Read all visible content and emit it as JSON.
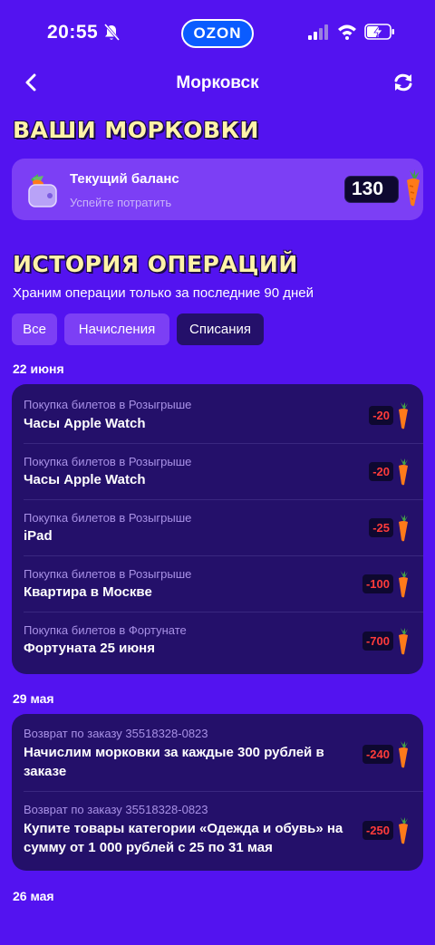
{
  "status_bar": {
    "time": "20:55",
    "brand": "OZON"
  },
  "header": {
    "title": "Морковск"
  },
  "balance_section": {
    "title": "ВАШИ МОРКОВКИ",
    "card_title": "Текущий баланс",
    "card_subtitle": "Успейте потратить",
    "amount": "130"
  },
  "history": {
    "title": "ИСТОРИЯ ОПЕРАЦИЙ",
    "subtitle": "Храним операции только за последние 90 дней",
    "filters": [
      {
        "label": "Все",
        "active": false
      },
      {
        "label": "Начисления",
        "active": false
      },
      {
        "label": "Списания",
        "active": true
      }
    ],
    "groups": [
      {
        "date": "22 июня",
        "operations": [
          {
            "category": "Покупка билетов в Розыгрыше",
            "name": "Часы Apple Watch",
            "amount": "-20"
          },
          {
            "category": "Покупка билетов в Розыгрыше",
            "name": "Часы Apple Watch",
            "amount": "-20"
          },
          {
            "category": "Покупка билетов в Розыгрыше",
            "name": "iPad",
            "amount": "-25"
          },
          {
            "category": "Покупка билетов в Розыгрыше",
            "name": "Квартира в Москве",
            "amount": "-100"
          },
          {
            "category": "Покупка билетов в Фортунате",
            "name": "Фортуната 25 июня",
            "amount": "-700"
          }
        ]
      },
      {
        "date": "29 мая",
        "operations": [
          {
            "category": "Возврат по заказу 35518328-0823",
            "name_line1": "Начислим морковки за каждые 300 рублей в",
            "name_line2": "заказе",
            "amount": "-240"
          },
          {
            "category": "Возврат по заказу 35518328-0823",
            "name_line1": "Купите товары категории «Одежда и обувь» на",
            "name_line2": "сумму от 1 000 рублей с 25 по 31 мая",
            "amount": "-250"
          }
        ]
      },
      {
        "date": "26 мая"
      }
    ]
  },
  "colors": {
    "background": "#5313f0",
    "card": "#24106a",
    "accent_yellow": "#fff3a8",
    "negative": "#ff3b3b"
  },
  "icons": [
    "bell-off-icon",
    "signal-icon",
    "wifi-icon",
    "battery-charging-icon",
    "back-arrow-icon",
    "refresh-icon",
    "wallet-carrot-icon",
    "carrot-icon"
  ]
}
